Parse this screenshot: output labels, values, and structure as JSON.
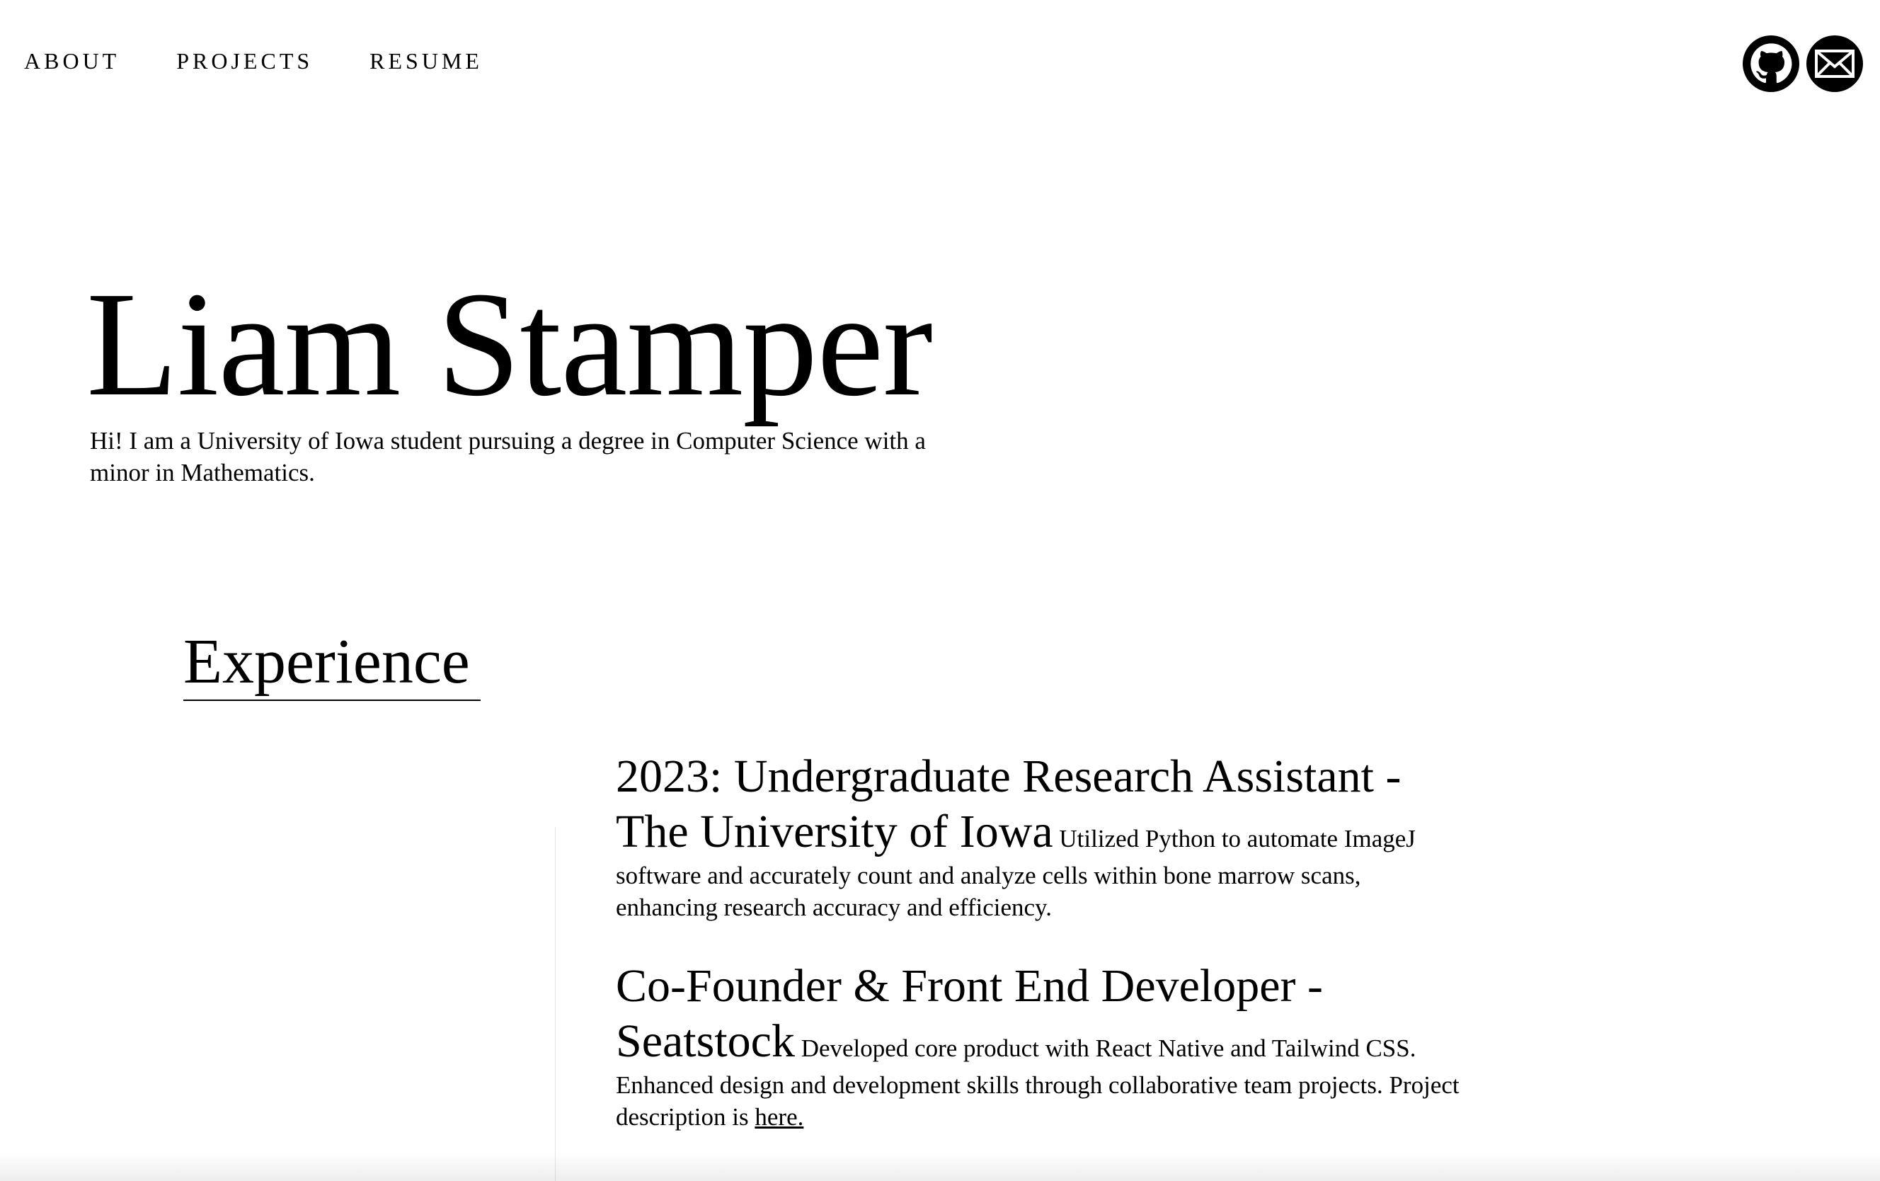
{
  "nav": {
    "items": [
      {
        "label": "ABOUT"
      },
      {
        "label": "PROJECTS"
      },
      {
        "label": "RESUME"
      }
    ]
  },
  "social": {
    "icons": [
      "github-icon",
      "mail-icon"
    ]
  },
  "hero": {
    "name": "Liam Stamper",
    "intro": "Hi! I am a University of Iowa student pursuing a degree in Computer Science with a minor in Mathematics."
  },
  "experience": {
    "heading": "Experience",
    "items": [
      {
        "title": "2023: Undergraduate Research Assistant - The University of Iowa",
        "description": "Utilized Python to automate ImageJ software and accurately count and analyze cells within bone marrow scans, enhancing research accuracy and efficiency."
      },
      {
        "title": "Co-Founder & Front End Developer - Seatstock",
        "description": "Developed core product with React Native and Tailwind CSS. Enhanced design and development skills through collaborative team projects. Project description is",
        "link_text": "here."
      }
    ]
  }
}
